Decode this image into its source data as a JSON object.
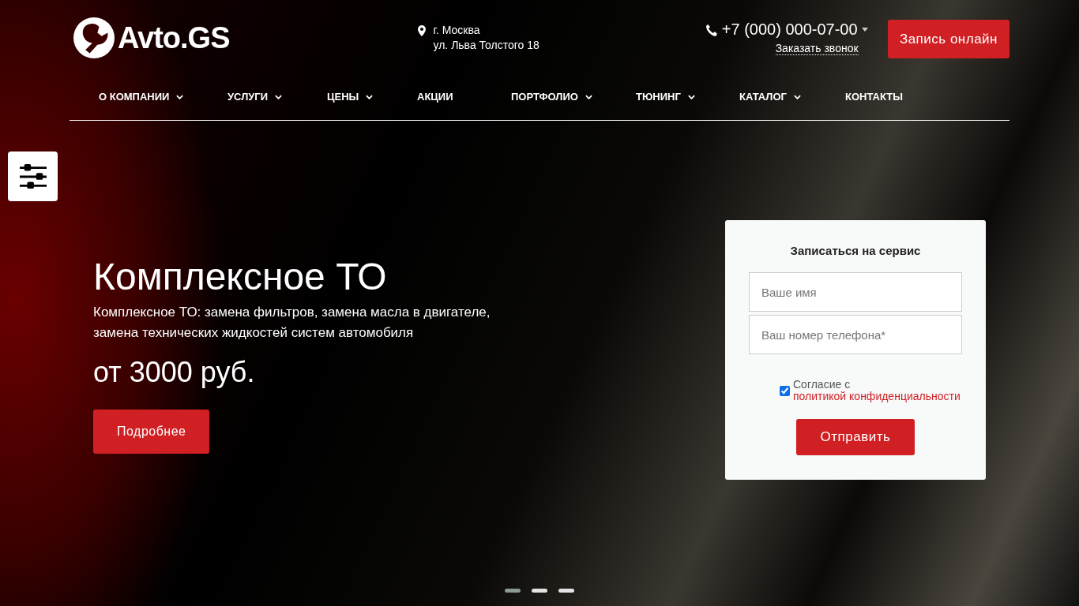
{
  "logo": {
    "text": "Avto.GS"
  },
  "address": {
    "city": "г. Москва",
    "street": "ул. Льва Толстого 18"
  },
  "phone": {
    "number": "+7 (000) 000-07-00",
    "callback_link": "Заказать звонок"
  },
  "header_button": "Запись онлайн",
  "nav": [
    {
      "label": "О КОМПАНИИ",
      "has_dropdown": true
    },
    {
      "label": "УСЛУГИ",
      "has_dropdown": true
    },
    {
      "label": "ЦЕНЫ",
      "has_dropdown": true
    },
    {
      "label": "АКЦИИ",
      "has_dropdown": false
    },
    {
      "label": "ПОРТФОЛИО",
      "has_dropdown": true
    },
    {
      "label": "ТЮНИНГ",
      "has_dropdown": true
    },
    {
      "label": "КАТАЛОГ",
      "has_dropdown": true
    },
    {
      "label": "КОНТАКТЫ",
      "has_dropdown": false
    }
  ],
  "hero": {
    "title": "Комплексное ТО",
    "description": "Комплексное ТО: замена фильтров, замена масла в двигателе, замена технических жидкостей систем автомобиля",
    "price": "от 3000 руб.",
    "button": "Подробнее"
  },
  "form": {
    "title": "Записаться на сервис",
    "fields": [
      {
        "placeholder": "Ваше имя"
      },
      {
        "placeholder": "Ваш номер телефона*"
      }
    ],
    "consent": {
      "checked": true,
      "text": "Согласие с",
      "link": "политикой конфиденциальности"
    },
    "submit": "Отправить"
  },
  "slider_dots": [
    {
      "selected": true
    },
    {
      "selected": false
    },
    {
      "selected": false
    }
  ]
}
